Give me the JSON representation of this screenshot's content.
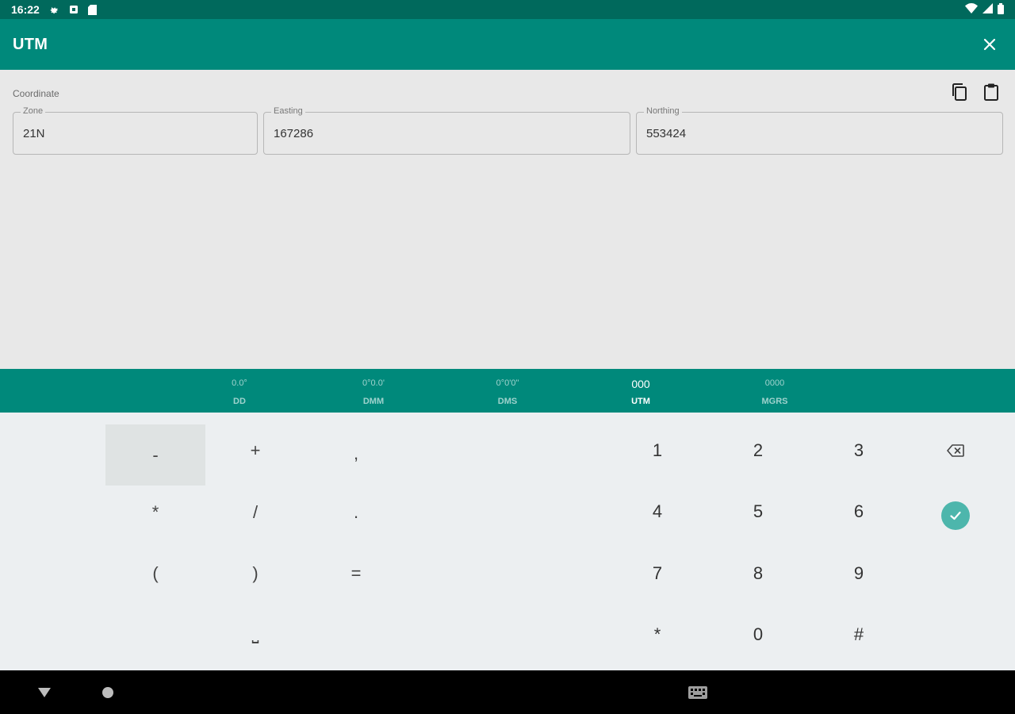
{
  "status_bar": {
    "time": "16:22",
    "icons_left": [
      "settings-icon",
      "notification-icon",
      "sd-card-icon"
    ],
    "icons_right": [
      "wifi-icon",
      "signal-icon",
      "battery-icon"
    ]
  },
  "app_bar": {
    "title": "UTM",
    "close_icon": "close-icon"
  },
  "coordinate": {
    "section_label": "Coordinate",
    "copy_icon": "copy-icon",
    "paste_icon": "paste-icon",
    "zone": {
      "label": "Zone",
      "value": "21N"
    },
    "easting": {
      "label": "Easting",
      "value": "167286"
    },
    "northing": {
      "label": "Northing",
      "value": "553424"
    }
  },
  "format_tabs": [
    {
      "glyph": "0.0°",
      "label": "DD",
      "active": false
    },
    {
      "glyph": "0°0.0'",
      "label": "DMM",
      "active": false
    },
    {
      "glyph": "0°0'0\"",
      "label": "DMS",
      "active": false
    },
    {
      "glyph": "000",
      "label": "UTM",
      "active": true
    },
    {
      "glyph": "0000",
      "label": "MGRS",
      "active": false
    }
  ],
  "keypad": {
    "symbol_keys": [
      [
        "-",
        "+",
        ","
      ],
      [
        "*",
        "/",
        "."
      ],
      [
        "(",
        ")",
        "="
      ],
      [
        "",
        "⎵",
        ""
      ]
    ],
    "number_keys": [
      [
        "1",
        "2",
        "3"
      ],
      [
        "4",
        "5",
        "6"
      ],
      [
        "7",
        "8",
        "9"
      ],
      [
        "*",
        "0",
        "#"
      ]
    ],
    "backspace_icon": "backspace-icon",
    "confirm_icon": "check-icon"
  },
  "nav_bar": {
    "back_icon": "back-icon",
    "home_icon": "home-icon",
    "keyboard_icon": "keyboard-icon"
  },
  "colors": {
    "status_bar": "#00695c",
    "primary": "#00897b",
    "accent": "#4db6ac",
    "background": "#e8e8e8",
    "keypad_background": "#eceff1"
  }
}
